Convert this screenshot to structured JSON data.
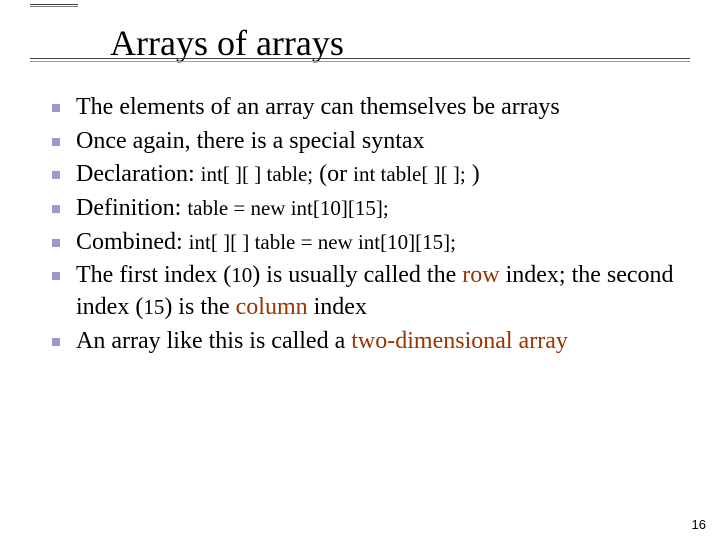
{
  "title": "Arrays of arrays",
  "bullets": {
    "b0": "The elements of an array can themselves be arrays",
    "b1": "Once again, there is a special syntax",
    "b2_lead": "Declaration: ",
    "b2_code1": "int[ ][ ] table;",
    "b2_mid": "  (or ",
    "b2_code2": "int table[ ][ ];",
    "b2_tail": " )",
    "b3_lead": "Definition: ",
    "b3_code": "table = new int[10][15];",
    "b4_lead": "Combined: ",
    "b4_code": "int[ ][ ] table = new int[10][15];",
    "b5_a": "The first index (",
    "b5_code1": "10",
    "b5_b": ") is usually called the ",
    "b5_row": "row",
    "b5_c": " index; the second index (",
    "b5_code2": "15",
    "b5_d": ") is the ",
    "b5_col": "column",
    "b5_e": " index",
    "b6_a": "An array like this is called a ",
    "b6_term": "two-dimensional array"
  },
  "page_number": "16"
}
